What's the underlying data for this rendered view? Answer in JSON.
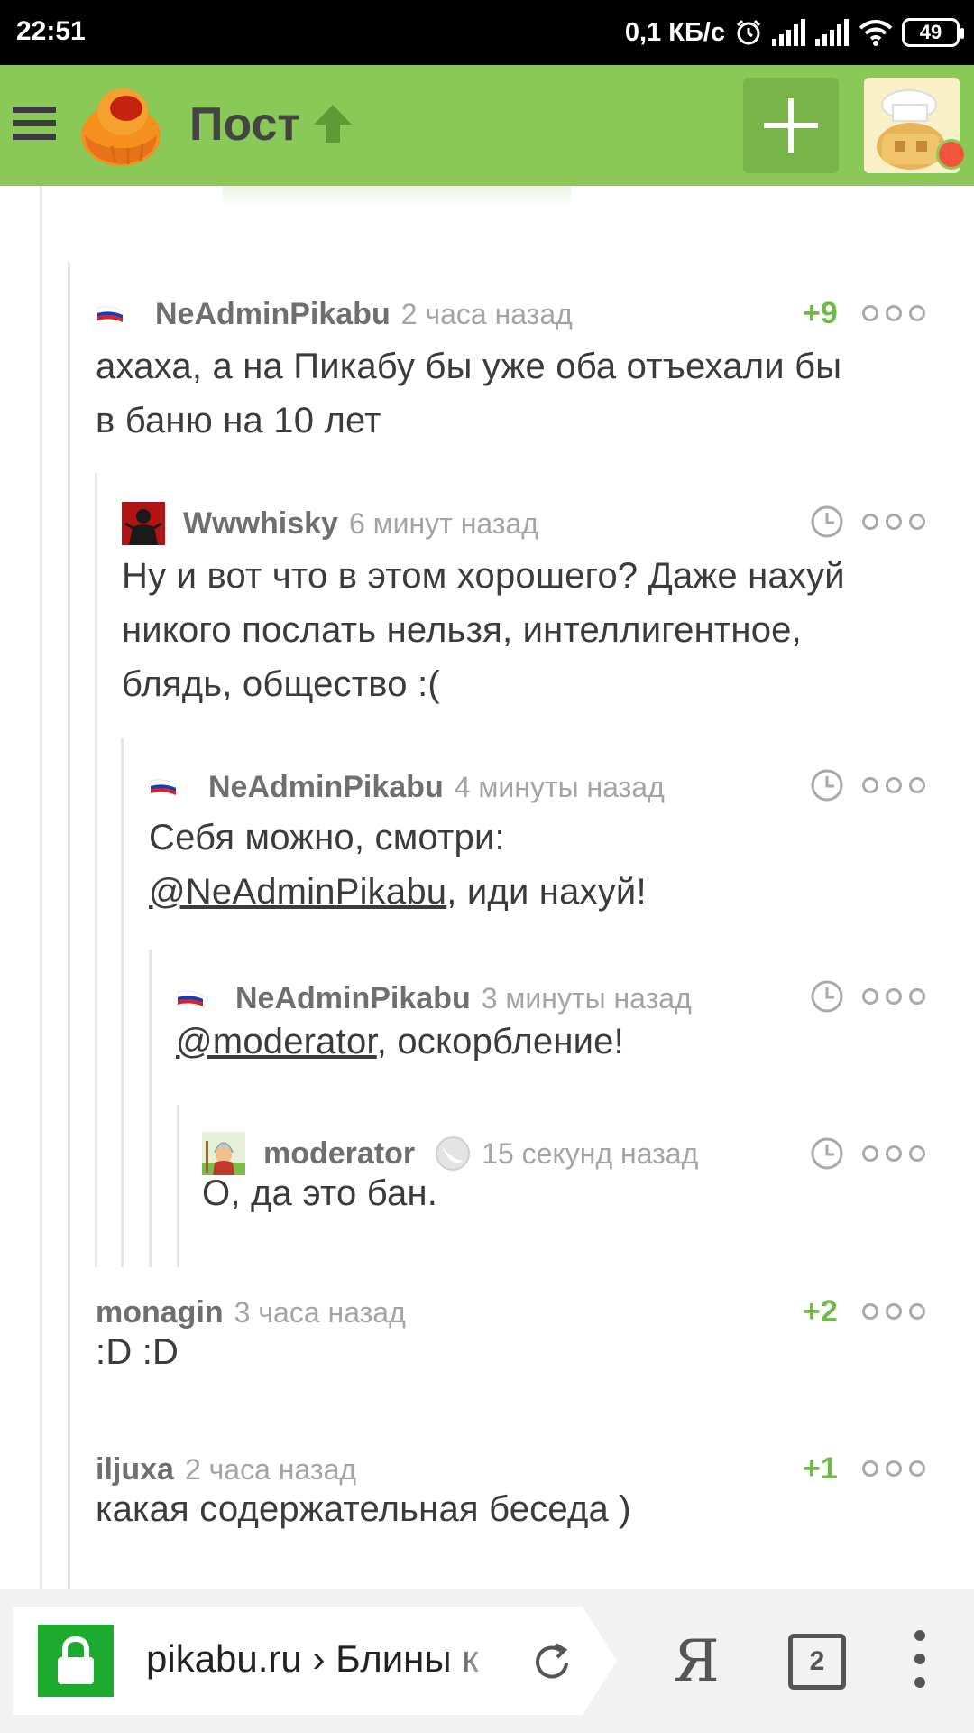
{
  "status_bar": {
    "time": "22:51",
    "network_speed": "0,1 КБ/с",
    "battery": "49",
    "icons": [
      "alarm-icon",
      "signal-icon",
      "signal-icon",
      "wifi-icon",
      "battery-icon"
    ]
  },
  "header": {
    "title": "Пост",
    "icons": [
      "menu-icon",
      "pikabu-logo",
      "arrow-up-icon",
      "plus-icon",
      "user-avatar"
    ]
  },
  "comments": [
    {
      "author": "NeAdminPikabu",
      "time": "2 часа назад",
      "rating": "+9",
      "body_lines": [
        "ахаха, а на Пикабу бы уже оба отъехали бы",
        "в баню на 10 лет"
      ]
    },
    {
      "author": "Wwwhisky",
      "time": "6 минут назад",
      "body_lines": [
        "Ну и вот что в этом хорошего? Даже нахуй",
        "никого послать нельзя, интеллигентное,",
        "блядь, общество :("
      ]
    },
    {
      "author": "NeAdminPikabu",
      "time": "4 минуты назад",
      "body_line1": "Себя можно, смотри:",
      "mention": "@NeAdminPikabu",
      "body_rest": ", иди нахуй!"
    },
    {
      "author": "NeAdminPikabu",
      "time": "3 минуты назад",
      "mention": "@moderator",
      "body_rest": ", оскорбление!"
    },
    {
      "author": "moderator",
      "time": "15 секунд назад",
      "body": "О, да это бан."
    },
    {
      "author": "monagin",
      "time": "3 часа назад",
      "rating": "+2",
      "body": ":D :D"
    },
    {
      "author": "iljuxa",
      "time": "2 часа назад",
      "rating": "+1",
      "body": "какая содержательная беседа )"
    }
  ],
  "browser_bar": {
    "url": "pikabu.ru › Блины к",
    "yandex_label": "Я",
    "tab_count": "2"
  },
  "colors": {
    "header_green": "#8ac858",
    "rating_green": "#70b84a",
    "lock_green": "#1eaa2e",
    "notification_red": "#f5543c"
  }
}
